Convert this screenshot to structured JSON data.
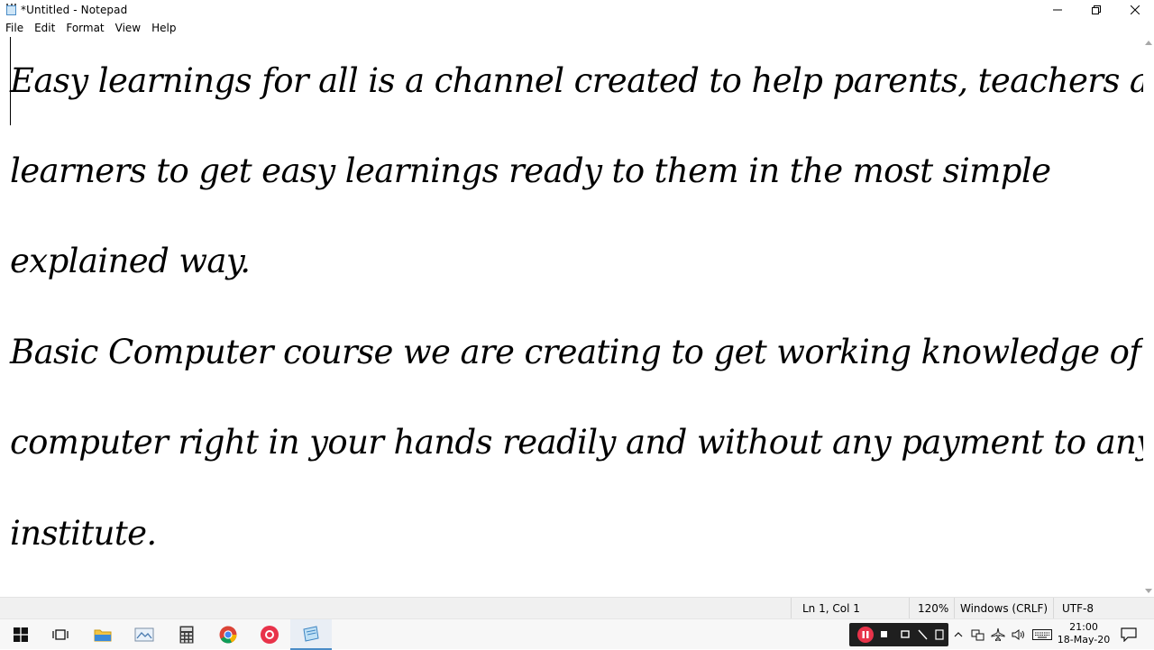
{
  "window": {
    "title": "*Untitled - Notepad",
    "controls": {
      "minimize": "minimize",
      "maximize": "restore",
      "close": "close"
    }
  },
  "menu": [
    "File",
    "Edit",
    "Format",
    "View",
    "Help"
  ],
  "editor": {
    "lines": [
      "Easy learnings for all is a channel created to help parents, teachers and",
      "learners to get easy learnings ready to them in the most simple",
      "explained way.",
      "Basic Computer course we are creating to get working knowledge of",
      "computer right in your hands readily and without any payment to any",
      "institute."
    ]
  },
  "status": {
    "position": "Ln 1, Col 1",
    "zoom": "120%",
    "line_ending": "Windows (CRLF)",
    "encoding": "UTF-8"
  },
  "taskbar": {
    "apps": [
      "start-icon",
      "task-view-icon",
      "file-explorer-icon",
      "photos-icon",
      "calculator-icon",
      "chrome-icon",
      "screen-recorder-icon",
      "notepad-icon"
    ],
    "clock_time": "21:00",
    "clock_date": "18-May-20"
  },
  "colors": {
    "accent": "#4a8cc7",
    "recorder": "#e8334a",
    "statusbar": "#f0f0f0"
  }
}
